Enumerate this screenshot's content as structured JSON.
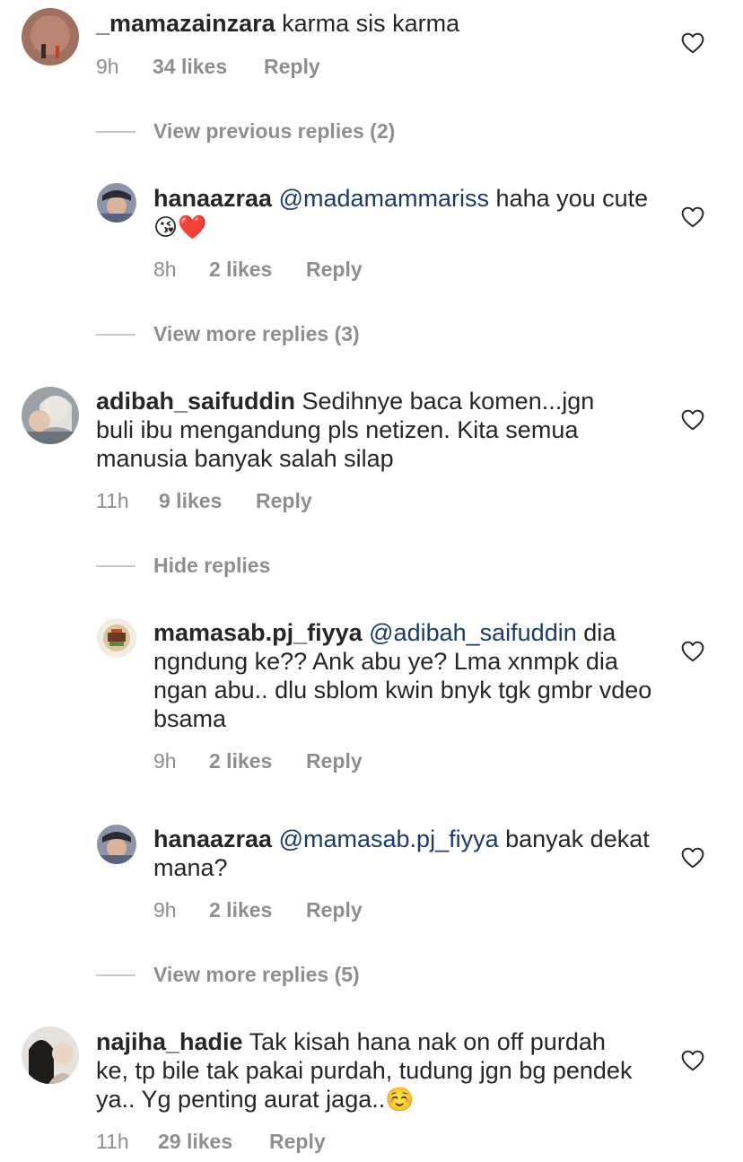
{
  "comments": [
    {
      "username": "_mamazainzara",
      "mention": "",
      "text": " karma sis karma",
      "time": "9h",
      "likes": "34 likes",
      "reply": "Reply"
    },
    {
      "username": "hanaazraa",
      "mention": "@madamammariss",
      "text": " haha you cute ",
      "emoji": "😘❤️",
      "time": "8h",
      "likes": "2 likes",
      "reply": "Reply"
    },
    {
      "username": "adibah_saifuddin",
      "mention": "",
      "text": " Sedihnye baca komen...jgn buli ibu mengandung pls netizen. Kita semua manusia banyak salah silap",
      "time": "11h",
      "likes": "9 likes",
      "reply": "Reply"
    },
    {
      "username": "mamasab.pj_fiyya",
      "mention": "@adibah_saifuddin",
      "text": " dia ngndung ke?? Ank abu ye? Lma xnmpk dia ngan abu.. dlu sblom kwin bnyk tgk gmbr vdeo bsama",
      "time": "9h",
      "likes": "2 likes",
      "reply": "Reply"
    },
    {
      "username": "hanaazraa",
      "mention": "@mamasab.pj_fiyya",
      "text": " banyak dekat mana?",
      "time": "9h",
      "likes": "2 likes",
      "reply": "Reply"
    },
    {
      "username": "najiha_hadie",
      "mention": "",
      "text": " Tak kisah hana nak on off purdah ke, tp bile tak pakai purdah, tudung jgn bg pendek ya.. Yg penting aurat jaga..",
      "emoji": "☺️",
      "time": "11h",
      "likes": "29 likes",
      "reply": "Reply"
    }
  ],
  "view_links": [
    "View previous replies (2)",
    "View more replies (3)",
    "Hide replies",
    "View more replies (5)"
  ],
  "icons": {
    "like": "heart-outline-icon"
  },
  "colors": {
    "text": "#262626",
    "meta": "#8e8e8e",
    "mention": "#1b3a6b",
    "heart": "#262626",
    "divider": "#c7c7c7"
  }
}
